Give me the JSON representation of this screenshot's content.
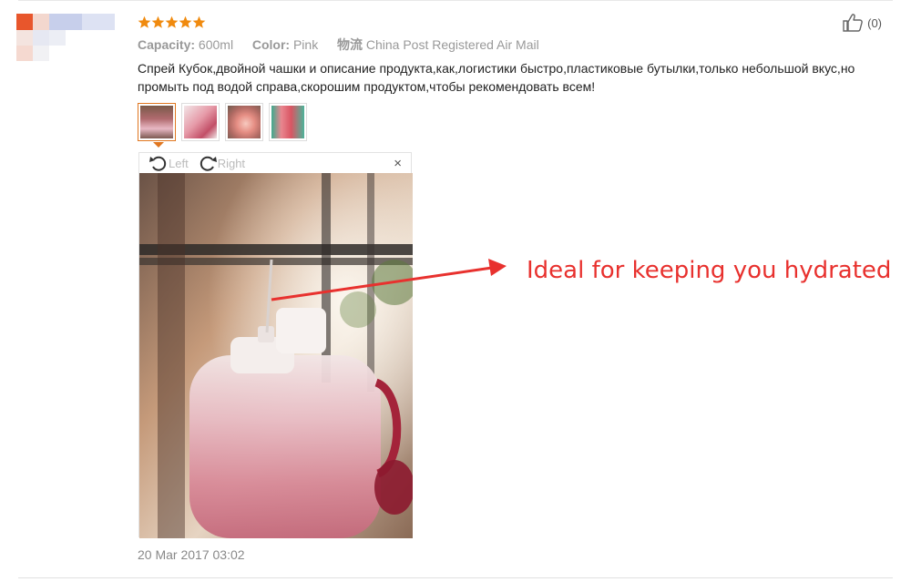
{
  "review": {
    "rating_stars": 5,
    "helpful_count": "(0)",
    "capacity_label": "Capacity:",
    "capacity_value": "600ml",
    "color_label": "Color:",
    "color_value": "Pink",
    "shipping_label": "物流",
    "shipping_value": "China Post Registered Air Mail",
    "text": "Спрей Кубок,двойной чашки и описание продукта,как,логистики быстро,пластиковые бутылки,только небольшой вкус,но промыть под водой справа,скорошим продуктом,чтобы рекомендовать всем!",
    "date": "20 Mar 2017 03:02"
  },
  "viewer": {
    "rotate_left_label": "Left",
    "rotate_right_label": "Right",
    "close_symbol": "×"
  },
  "annotation": {
    "text": "Ideal for keeping you hydrated",
    "color": "#e8312e"
  },
  "colors": {
    "star": "#f08a0e",
    "accent_border": "#e0761f"
  },
  "icons": {
    "star": "star-icon",
    "helpful": "thumbs-up-icon",
    "rotate_left": "rotate-left-icon",
    "rotate_right": "rotate-right-icon",
    "close": "close-icon"
  }
}
